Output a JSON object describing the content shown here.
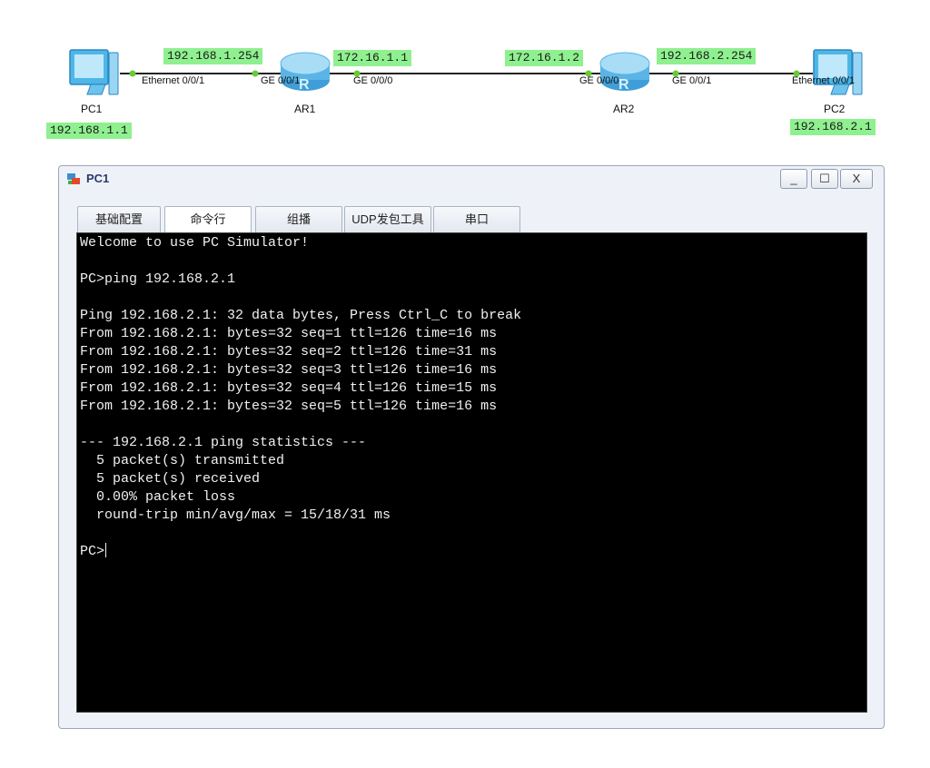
{
  "topology": {
    "devices": [
      {
        "id": "pc1",
        "label": "PC1",
        "type": "pc"
      },
      {
        "id": "ar1",
        "label": "AR1",
        "type": "router"
      },
      {
        "id": "ar2",
        "label": "AR2",
        "type": "router"
      },
      {
        "id": "pc2",
        "label": "PC2",
        "type": "pc"
      }
    ],
    "ports": {
      "pc1_eth": "Ethernet 0/0/1",
      "ar1_ge001": "GE 0/0/1",
      "ar1_ge000": "GE 0/0/0",
      "ar2_ge000": "GE 0/0/0",
      "ar2_ge001": "GE 0/0/1",
      "pc2_eth": "Ethernet 0/0/1"
    },
    "ips": {
      "pc1": "192.168.1.1",
      "ar1_g001": "192.168.1.254",
      "ar1_g000": "172.16.1.1",
      "ar2_g000": "172.16.1.2",
      "ar2_g001": "192.168.2.254",
      "pc2": "192.168.2.1"
    },
    "colors": {
      "ip_highlight": "#8ff08f",
      "link": "#222222",
      "port_dot": "#66cc33"
    }
  },
  "window": {
    "title": "PC1",
    "icon": "pc-simulator-icon",
    "controls": {
      "minimize": "_",
      "maximize": "☐",
      "close": "X"
    },
    "tabs": [
      {
        "label": "基础配置"
      },
      {
        "label": "命令行"
      },
      {
        "label": "组播"
      },
      {
        "label": "UDP发包工具"
      },
      {
        "label": "串口"
      }
    ],
    "active_tab": "命令行",
    "terminal": {
      "lines": [
        "Welcome to use PC Simulator!",
        "",
        "PC>ping 192.168.2.1",
        "",
        "Ping 192.168.2.1: 32 data bytes, Press Ctrl_C to break",
        "From 192.168.2.1: bytes=32 seq=1 ttl=126 time=16 ms",
        "From 192.168.2.1: bytes=32 seq=2 ttl=126 time=31 ms",
        "From 192.168.2.1: bytes=32 seq=3 ttl=126 time=16 ms",
        "From 192.168.2.1: bytes=32 seq=4 ttl=126 time=15 ms",
        "From 192.168.2.1: bytes=32 seq=5 ttl=126 time=16 ms",
        "",
        "--- 192.168.2.1 ping statistics ---",
        "  5 packet(s) transmitted",
        "  5 packet(s) received",
        "  0.00% packet loss",
        "  round-trip min/avg/max = 15/18/31 ms",
        "",
        "PC>"
      ]
    }
  }
}
